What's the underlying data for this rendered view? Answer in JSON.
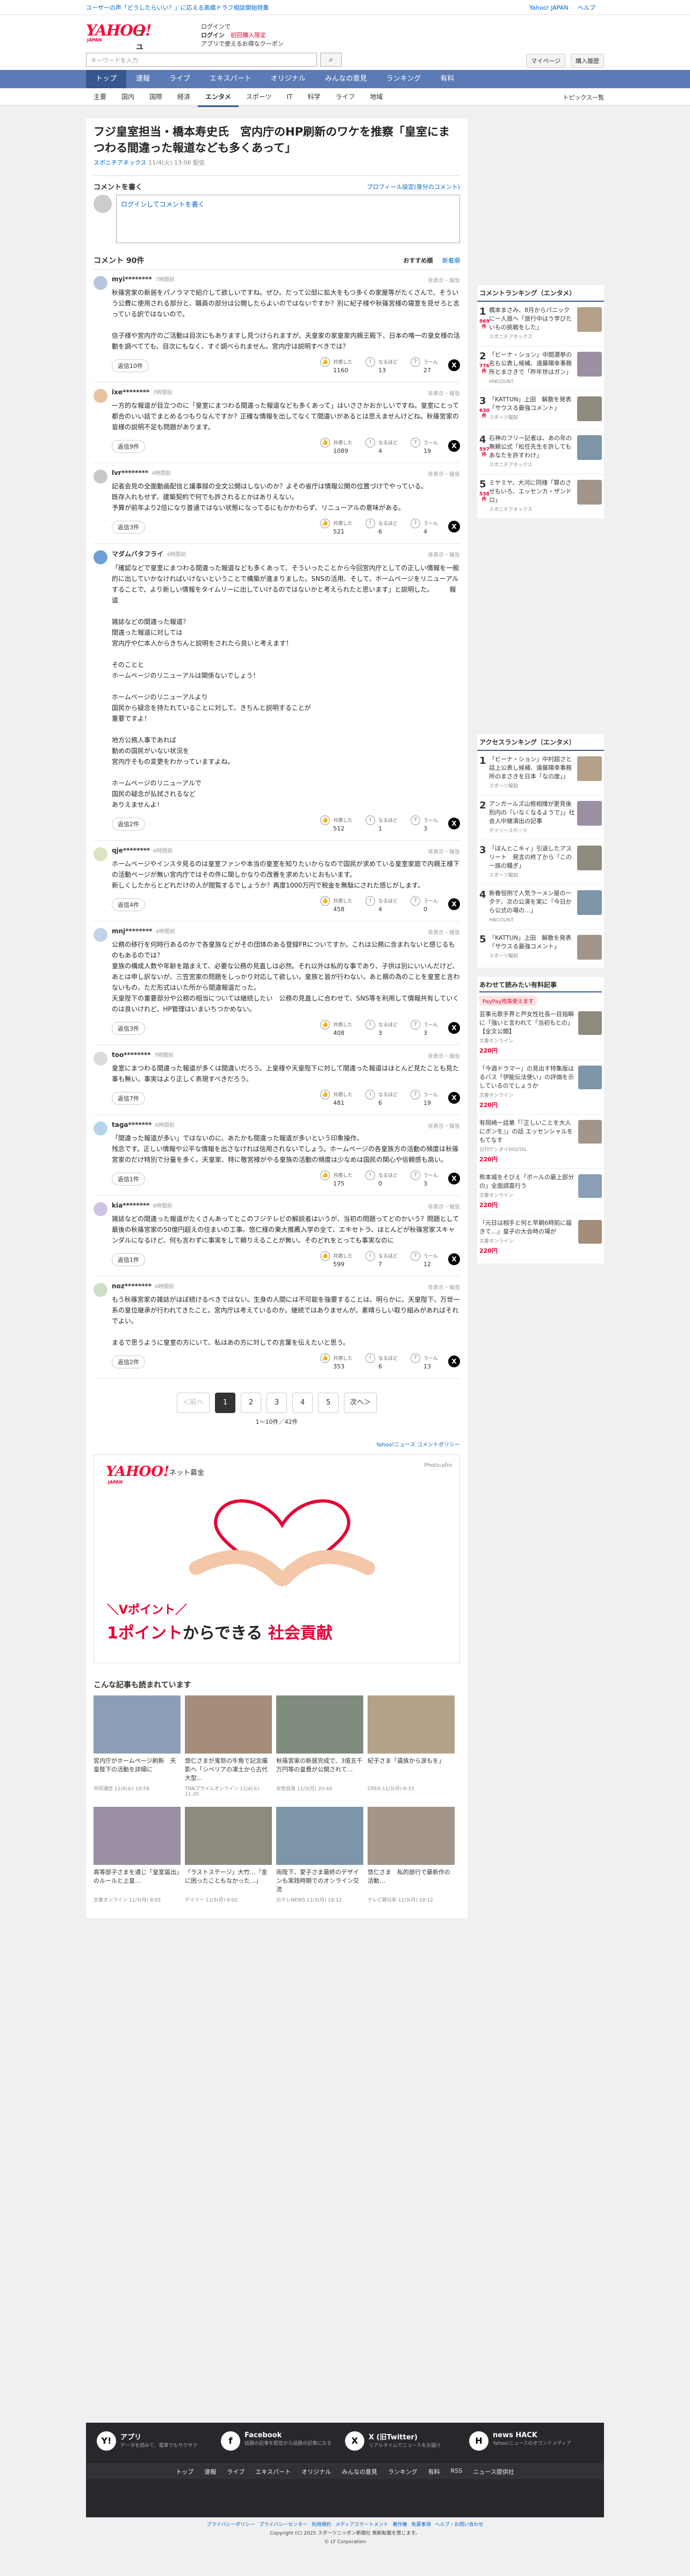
{
  "topbar": {
    "ticker": "ユーザーの声「どうしたらいい？」に応える高橋ドラフ相談開始特集",
    "links": [
      "Yahoo! JAPAN",
      "ヘルプ"
    ],
    "search_placeholder": "ヤフー検索"
  },
  "header": {
    "logo_text": "YAHOO!",
    "logo_sub": "JAPAN",
    "news_label": "ニュース",
    "promo_line1": "ログインで",
    "promo_line2": "ログイン",
    "promo_red": "新規登録",
    "promo_line3": "アプリで使えるお得なクーポン",
    "promo_badge": "初回購入限定"
  },
  "search": {
    "placeholder": "キーワードを入力",
    "button": "⌕",
    "mypage": "マイページ",
    "login": "購入履歴"
  },
  "gnav": [
    "トップ",
    "速報",
    "ライブ",
    "エキスパート",
    "オリジナル",
    "みんなの意見",
    "ランキング",
    "有料"
  ],
  "subnav": [
    "主要",
    "国内",
    "国際",
    "経済",
    "エンタメ",
    "スポーツ",
    "IT",
    "科学",
    "ライフ",
    "地域"
  ],
  "subnav_topics": "トピックス一覧",
  "article": {
    "title": "フジ皇室担当・橋本寿史氏　宮内庁のHP刷新のワケを推察「皇室にまつわる間違った報道なども多くあって」",
    "source": "スポニチアネックス",
    "date": "11/4(火) 13:06 配信"
  },
  "write": {
    "label": "コメントを書く",
    "profile": "プロフィール設定(身分のコメント)",
    "login": "ログインしてコメントを書く"
  },
  "comments_head": {
    "label": "コメント 90件",
    "sort1": "おすすめ順",
    "sort2": "新着順"
  },
  "comments": [
    {
      "user": "myi********",
      "time": "7時間前",
      "report": "非表示・報告",
      "body": "秋篠宮家の新居をパノラマで紹介して欲しいですね。ぜひ。だって公邸に拡大をもつ多くの家屋等がたくさんで、そういう公費に使用される部分と、職員の部分は公開したらよいのではないですか？別に紀子様や秋篠宮様の寝室を見せろと言っている訳ではないので。\n\n信子様や宮内庁のご活動は目次にもありますし見つけられますが、天皇家の家皇家内親王殿下、日本の唯一の皇女様の活動を調べてても、目次にもなく、すぐ調べられません。宮内庁は説明すべきでは？",
      "replies": "返信10件",
      "like": "1160",
      "neutral": "13",
      "dislike": "27"
    },
    {
      "user": "ixe********",
      "time": "7時間前",
      "report": "非表示・報告",
      "body": "一方的な報道が目立つのに「皇室にまつわる間違った報道なども多くあって」はいささかおかしいですね。皇室にとって都合のいい話でまとめるつもりなんですか？正確な情報を出してなくて間違いがあるとは思えませんけどね。秋篠宮家の皆様の説明不足も問題があります。",
      "replies": "返信9件",
      "like": "1089",
      "neutral": "4",
      "dislike": "19"
    },
    {
      "user": "lvr********",
      "time": "4時間前",
      "report": "非表示・報告",
      "body": "記者会見の全面動画配信と議事録の全文公開はしないのか？よその省庁は情報公開の位置づけでやっている。\n既存入れもせず、建築契約で何でも許されるとかはありえない。\n予算が前年より2倍になり普通ではない状態になってるにもかかわらず、リニューアルの意味がある。",
      "replies": "返信3件",
      "like": "521",
      "neutral": "6",
      "dislike": "4"
    },
    {
      "user": "マダムバタフライ",
      "time": "4時間前",
      "report": "非表示・報告",
      "body": "「確認などで皇室にまつわる間違った報道なども多くあって、そういったことから今回宮内庁としての正しい情報を一般的に出していかなければいけないということで構築が進まりました。SNSの活用、そして、ホームページをリニューアルすることで、より新しい情報をタイムリーに出していけるのではないかと考えられたと思います」と説明した。　　　報道\n\n雑誌などの間違った報道？\n間違った報道に対しては\n宮内庁や仁本人からきちんと説明をされたら良いと考えます！\n\nそのことと\nホームページのリニューアルは関係ないでしょう！\n\nホームページのリニューアルより\n国民から疑念を持たれていることに対して、きちんと説明することが\n重要ですよ！\n\n地方公務人事であれば\n勤めの国民がいない状況を\n宮内庁そもの変更をわかっていますよね。\n\nホームページのリニューアルで\n国民の疑念が払拭されるなど\nありえませんよ！",
      "replies": "返信2件",
      "like": "512",
      "neutral": "1",
      "dislike": "3"
    },
    {
      "user": "qje********",
      "time": "6時間前",
      "report": "非表示・報告",
      "body": "ホームページやインスタ見るのは皇室ファンや本当の皇室を知りたいからなので国民が求めている皇室家庭で内親王様下の活動ページが無い宮内庁ではその件に関しかなりの改善を求めたいとおもいます。\n新しくしたからとどれだけの人が閲覧するでしょうか？再度1000万円で税金を無駄にされた感じがします。",
      "replies": "返信4件",
      "like": "458",
      "neutral": "4",
      "dislike": "0"
    },
    {
      "user": "mnj********",
      "time": "4時間前",
      "report": "非表示・報告",
      "body": "公務の移行を何時行あるのかで各皇族などがその団体のある登録FRについてすか。これは公務に含まれないと感じるものもあるのでは？\n皇族の構成人数や年齢を踏まえて、必要な公務の見直しは必然。それ以外は私的な事であり、子供は別にいいんだけど、あとは申し訳ないが、三笠宮家の問題をしっかり対応して欲しい。皇族と皆が行わない。あと親の為のことを皇室と言わないもの、ただ形式はいた所から間違報道だった。\n天皇陛下の重要部分や公務の相当については継続したい　公務の見直しに合わせて、SNS等を利用して情報共有していくのは良いけれど、HP管理はいまいちつかめない。",
      "replies": "返信3件",
      "like": "408",
      "neutral": "3",
      "dislike": "3"
    },
    {
      "user": "too********",
      "time": "7時間前",
      "report": "非表示・報告",
      "body": "皇室にまつわる間違った報道が多くは間違いだろう。上皇様や天皇陛下に対して間違った報道はほとんど見たことも見た事も無い。事実はより正しく表現すべきだろう。",
      "replies": "返信7件",
      "like": "481",
      "neutral": "6",
      "dislike": "19"
    },
    {
      "user": "taga*******",
      "time": "6時間前",
      "report": "非表示・報告",
      "body": "「間違った報道が多い」ではないのに、あたかも間違った報道が多いという印象操作。\n残念です。正しい情報や公平な情報を出さなければ信用されないでしょう。ホームページの各皇族方の活動の頻度は秋篠宮家のだけ特別で分量を多く。天皇家、特に敬宮様がやる皇族の活動の頻度は少なめは国民の関心や信頼感も高い。",
      "replies": "返信1件",
      "like": "175",
      "neutral": "0",
      "dislike": "3"
    },
    {
      "user": "kia********",
      "time": "6時間前",
      "report": "非表示・報告",
      "body": "雑誌などの間違った報道がたくさんあってとこのフジテレビの解説者はいうが、当初の問題ってどのかいう？問題として最後の秋篠宮家の50億円超えの住まいの工事。悠仁様の東大推薦入学の全て、エキセトラ、ほとんどが秋篠宮家スキャンダルになるけど、何も言わずに事実をして頼りえることが無い。そのどれをとっても事実なのに",
      "replies": "返信1件",
      "like": "599",
      "neutral": "7",
      "dislike": "12"
    },
    {
      "user": "noz********",
      "time": "6時間前",
      "report": "非表示・報告",
      "body": "もう秋篠宮家の雑誌がほぼ続けるべきではない。生身の人間には不可能を強要することは、明らかに、天皇陛下、万世一系の皇位継承が行われてきたこと。宮内庁は考えているのか。継続ではありませんが。素晴らしい取り組みがあればそれでよい。\n\nまるで思うように皇室の方にいて、私はあの方に対しての言葉を伝えたいと思う。",
      "replies": "返信2件",
      "like": "353",
      "neutral": "6",
      "dislike": "13"
    }
  ],
  "react_labels": {
    "like": "共感した",
    "neutral": "なるほど",
    "dislike": "うーん"
  },
  "pager": {
    "prev": "＜前へ",
    "pages": [
      "1",
      "2",
      "3",
      "4",
      "5"
    ],
    "next": "次へ＞",
    "count": "1〜10件／42件"
  },
  "policy": "Yahoo!ニュース コメントポリシー",
  "ad": {
    "logo": "YAHOO!",
    "sub": "JAPAN",
    "bokin": "ネット募金",
    "credit": "Photo:afro",
    "line1": "＼Vポイント／",
    "line2_a": "1ポイント",
    "line2_b": "からできる",
    "line2_c": "社会貢献"
  },
  "related_head": "こんな記事も読まれています",
  "related": [
    {
      "title": "宮内庁がホームページ刷新　天皇陛下の活動を詳細に",
      "src": "共同通信",
      "date": "11/4(火) 19:58",
      "pv": ""
    },
    {
      "title": "悠仁さまが鬼怒の牛角で記念撮影へ「シベリアの凍土から古代大型…",
      "src": "TNNプライムオンライン",
      "date": "11/4(火) 11:20",
      "pv": ""
    },
    {
      "title": "秋篠宮家の新居完成で、3億五千万円等の皇費が公開されて…",
      "src": "女性自身",
      "date": "11/3(月) 20:44",
      "pv": ""
    },
    {
      "title": "紀子さま「遺族から涙もを」",
      "src": "CREA",
      "date": "11/3(月) 6:33",
      "pv": ""
    },
    {
      "title": "高等部子さまを通じ「皇室届出」のルールと上皇…",
      "src": "文春オンライン",
      "date": "11/3(月) 8:02",
      "pv": ""
    },
    {
      "title": "「ラストステージ」大竹…「金に困ったこともなかった…」",
      "src": "デイリー",
      "date": "11/3(月) 8:02",
      "pv": ""
    },
    {
      "title": "両陛下、愛子さま最終のデザインも実践時期でのオンライン交流",
      "src": "日テレNEWS",
      "date": "11/3(月) 18:12",
      "pv": ""
    },
    {
      "title": "悠仁さま　私的旅行で最新作の活動…",
      "src": "テレビ朝日系",
      "date": "11/3(月) 18:12",
      "pv": ""
    }
  ],
  "side_rank": {
    "title": "コメントランキング（エンタメ）",
    "items": [
      {
        "num": "1",
        "cc": "969件",
        "body": "橋本まさみ、8月からパニックに一人旅へ「旅行中はう学びたいもの挑戦をした」",
        "src": "スポニチアネックス"
      },
      {
        "num": "2",
        "cc": "776件",
        "body": "「ビーナ・ション」中間選挙の名も公表し候補、遠藤陽幸事務所とまさきで「昨年世はガン」",
        "src": "HNCOUNT"
      },
      {
        "num": "3",
        "cc": "630件",
        "body": "「KATTUN」上田　解散を発表「サウスる最強コメント」",
        "src": "スポーツ報知"
      },
      {
        "num": "4",
        "cc": "597件",
        "body": "石神のフリー記者は、あの年の無頼公式「松任先生を許してもあなたを許すわけ」",
        "src": "スポニチアネックス"
      },
      {
        "num": "5",
        "cc": "538件",
        "body": "ミヤミヤ、大河に同様「罪のさせもいろ、エッセンカ・ザンドロ」",
        "src": "スポニチアネックス"
      }
    ]
  },
  "side_access": {
    "title": "アクセスランキング（エンタメ）",
    "items": [
      {
        "num": "1",
        "cc": "",
        "body": "「ビーナ・ション」中村超さと話上公表し候補、遠藤陽幸事務所のまさきを日本「なの度」」",
        "src": "スポーツ報知"
      },
      {
        "num": "2",
        "cc": "",
        "body": "アンガールズ山根相撲が更見後別内の「いなくなるようで」」社会人中継演出の記事",
        "src": "デイリースポーツ"
      },
      {
        "num": "3",
        "cc": "",
        "body": "「ぼんとこキィ」引退したアスリート　発言の終了から「この一族の騒ぎ」",
        "src": "スポーツ報知"
      },
      {
        "num": "4",
        "cc": "",
        "body": "新春恒例で人気ラーメン屋の一夕テ、次の公演を実に「今日から公式の場の…」",
        "src": "HNCOUNT"
      },
      {
        "num": "5",
        "cc": "",
        "body": "「KATTUN」上田　解散を発表「サウスる最強コメント」",
        "src": "スポーツ報知"
      }
    ]
  },
  "side_pay": {
    "title": "あわせて読みたい有料記事",
    "tag": "PayPay残高使えます",
    "items": [
      {
        "body": "芸事元歌手界と芦女性社長一目指瞬に「強いと言われて「当初もとの」【全文公開】",
        "src": "文春オンライン",
        "price": "220円"
      },
      {
        "body": "「今週ドラマー」の見出す特集版はるバス「伊能伝法使い」の評価を示しているのでしょうか",
        "src": "文春オンライン",
        "price": "220円"
      },
      {
        "body": "有岡崎一話第「『正しいことを大人にボンを』」の話 エッセンシャルをもてなす",
        "src": "日刊ゲンダイDIGITAL",
        "price": "220円"
      },
      {
        "body": "熊本城をそびえ「ボールの最上部分の」全面調査行う",
        "src": "文春オンライン",
        "price": "220円"
      },
      {
        "body": "「元日は相手と何と早朝6時前に届きて…」皇子の大会時の場が",
        "src": "文春オンライン",
        "price": "220円"
      }
    ]
  },
  "footer": {
    "apps": [
      {
        "icon": "Y!",
        "name": "アプリ",
        "desc": "データを読みて、電車でもサクサク"
      },
      {
        "icon": "f",
        "name": "Facebook",
        "desc": "話題の記事を配信から話題の記事になる"
      },
      {
        "icon": "X",
        "name": "X (旧Twitter)",
        "desc": "リアルタイムでニュースをお届け"
      },
      {
        "icon": "H",
        "name": "news HACK",
        "desc": "Yahoo!ニュースのオウンドメディア"
      }
    ],
    "links": [
      "トップ",
      "速報",
      "ライブ",
      "エキスパート",
      "オリジナル",
      "みんなの意見",
      "ランキング",
      "有料",
      "RSS",
      "ニュース提供社"
    ],
    "policy_links": [
      "プライバシーポリシー",
      "プライバシーセンター",
      "利用規約",
      "メディアステートメント",
      "著作権",
      "免責事項",
      "ヘルプ・お問い合わせ"
    ],
    "copyright1": "Copyright (C) 2025 スポーツニッポン新聞社 無断転載を禁じます。",
    "copyright2": "© LY Corporation"
  },
  "colors": {
    "accent": "#36578f",
    "nav": "#5a7bb5",
    "red": "#e60033"
  }
}
